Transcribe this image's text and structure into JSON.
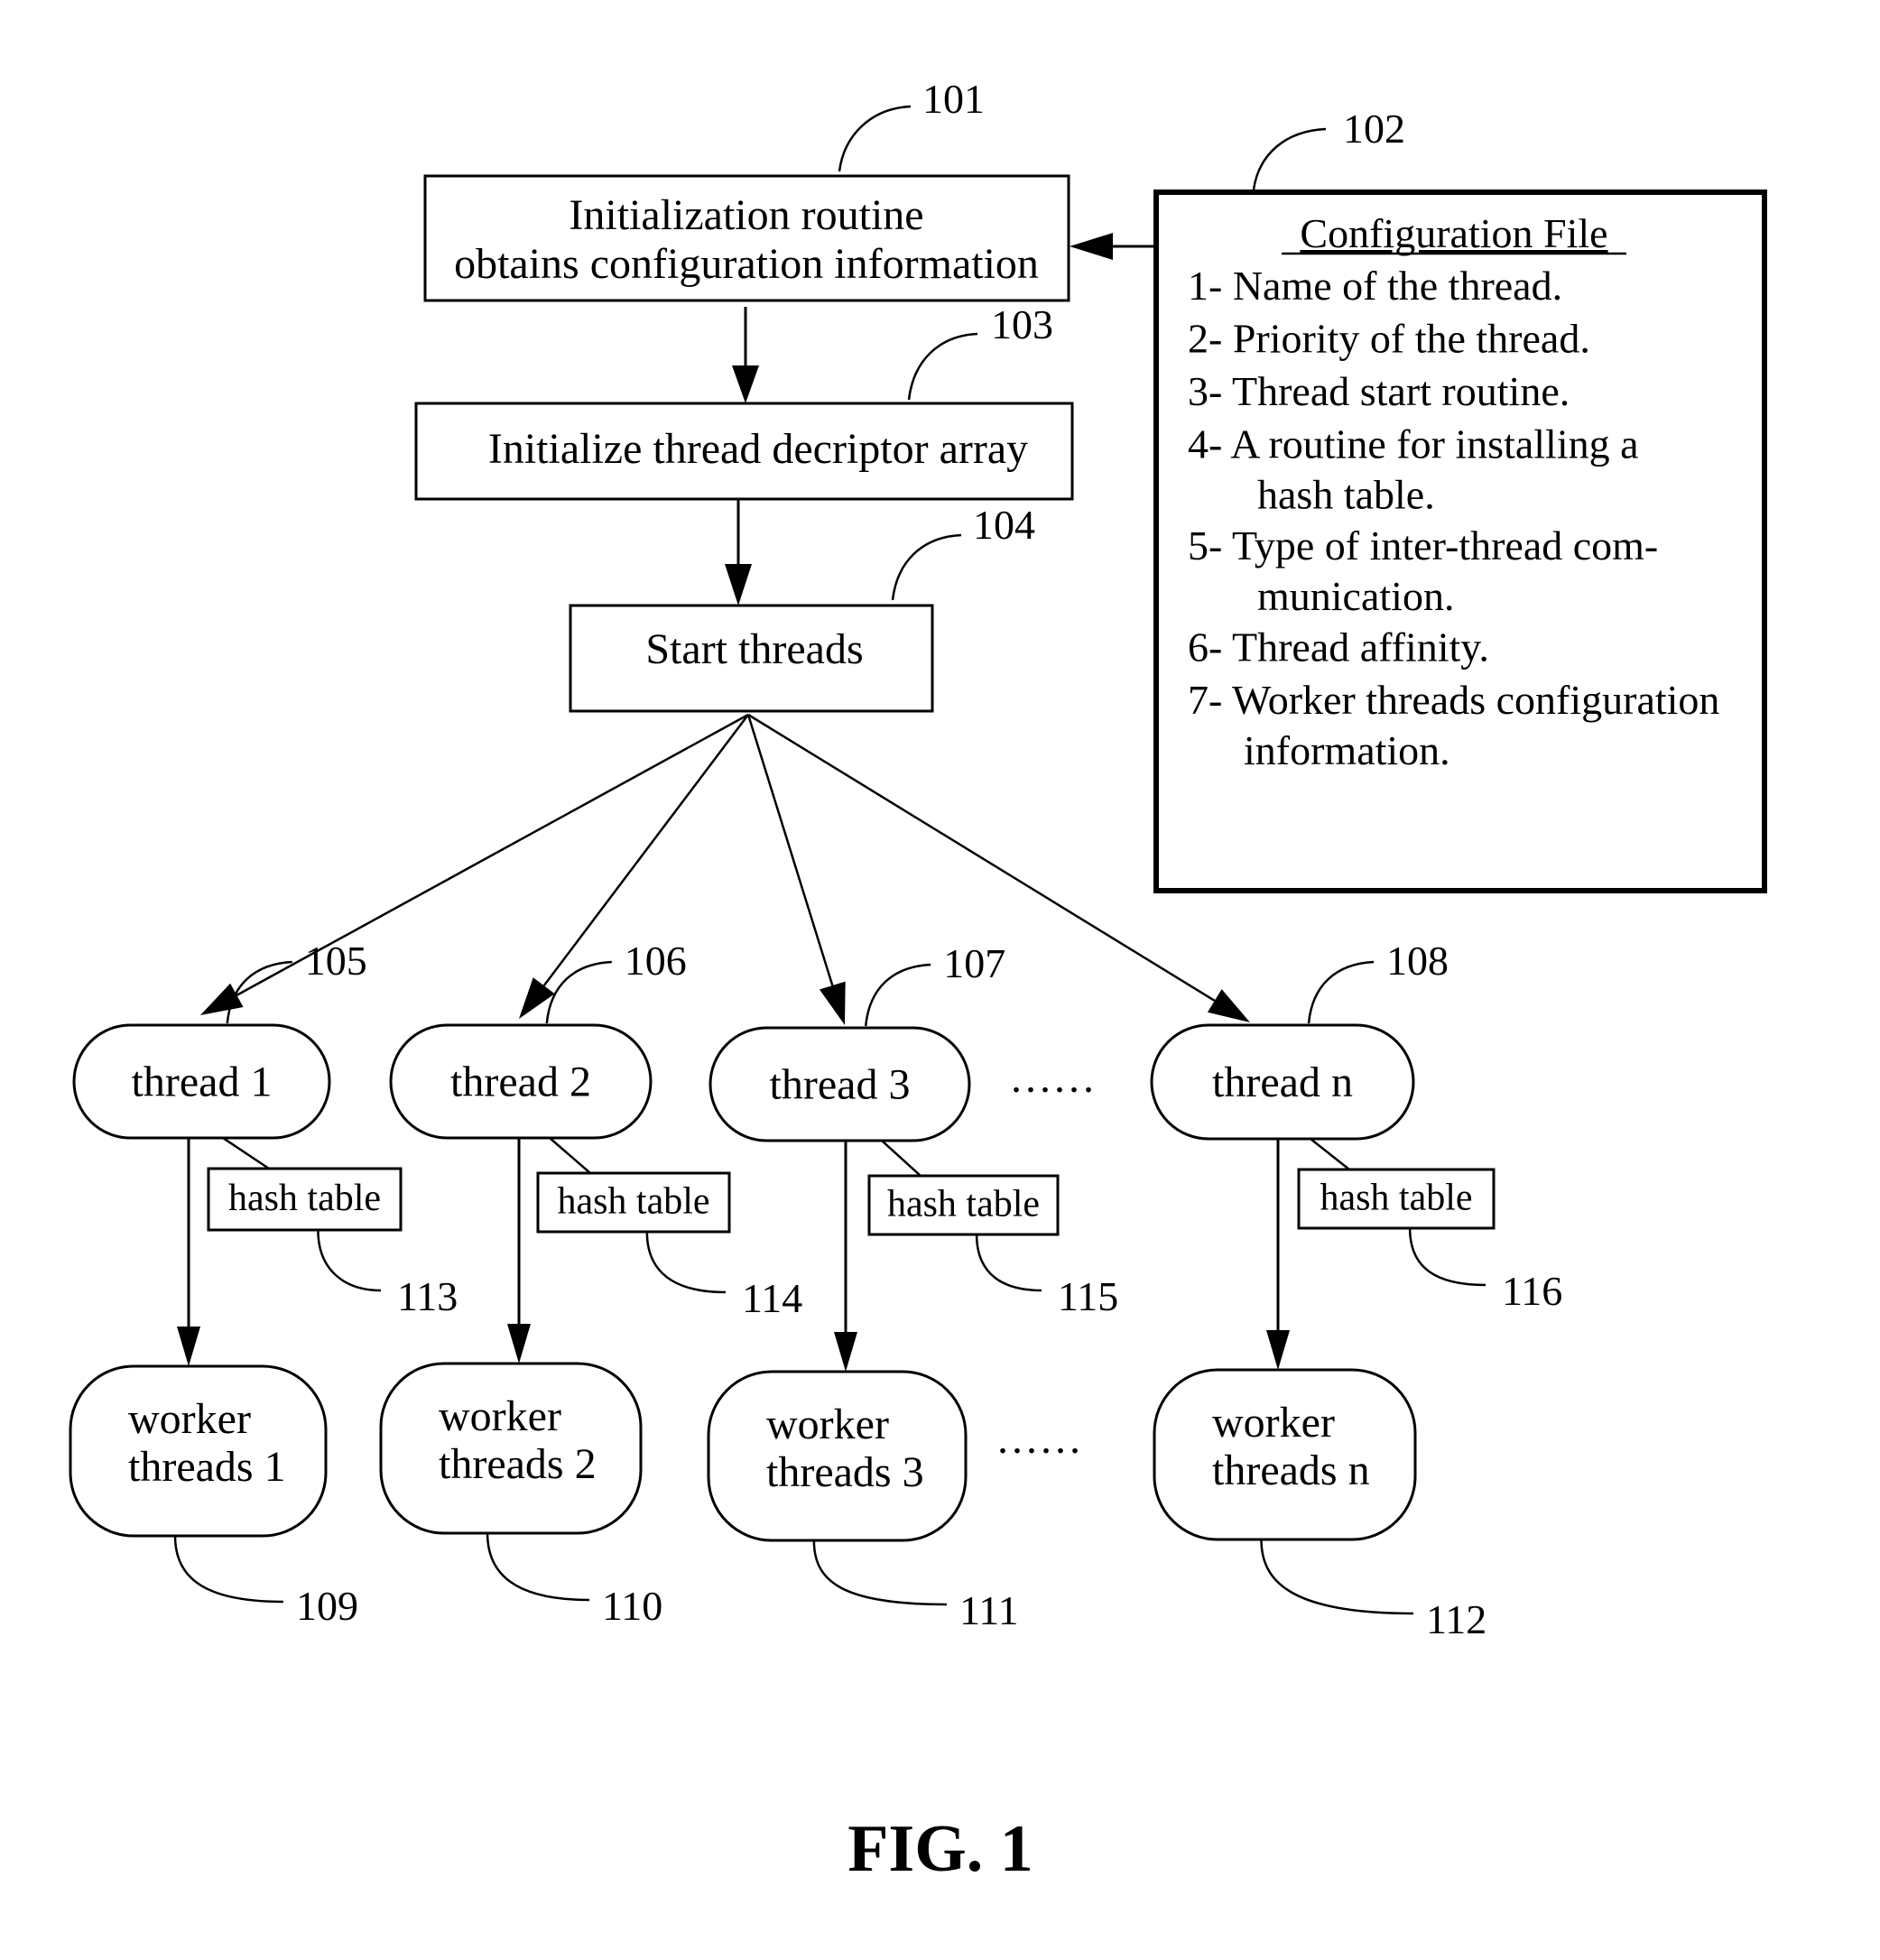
{
  "figure": {
    "caption": "FIG. 1",
    "init_routine": {
      "ref": "101",
      "lines": [
        "Initialization routine",
        "obtains configuration information"
      ]
    },
    "config_file": {
      "ref": "102",
      "title": "Configuration File",
      "items": [
        [
          "1- Name of the thread."
        ],
        [
          "2- Priority of the thread."
        ],
        [
          "3- Thread start routine."
        ],
        [
          "4-  A routine for installing a",
          "hash table."
        ],
        [
          "5- Type of inter-thread com-",
          "munication."
        ],
        [
          "6- Thread affinity."
        ],
        [
          "7- Worker threads configuration",
          "information."
        ]
      ]
    },
    "init_descriptor": {
      "ref": "103",
      "label": "Initialize thread decriptor array"
    },
    "start_threads": {
      "ref": "104",
      "label": "Start threads"
    },
    "threads": [
      {
        "label": "thread 1",
        "ref": "105",
        "hash_label": "hash table",
        "hash_ref": "113",
        "worker_lines": [
          "worker",
          "threads 1"
        ],
        "worker_ref": "109"
      },
      {
        "label": "thread 2",
        "ref": "106",
        "hash_label": "hash table",
        "hash_ref": "114",
        "worker_lines": [
          "worker",
          "threads 2"
        ],
        "worker_ref": "110"
      },
      {
        "label": "thread 3",
        "ref": "107",
        "hash_label": "hash table",
        "hash_ref": "115",
        "worker_lines": [
          "worker",
          "threads 3"
        ],
        "worker_ref": "111"
      },
      {
        "label": "thread n",
        "ref": "108",
        "hash_label": "hash table",
        "hash_ref": "116",
        "worker_lines": [
          "worker",
          "threads n"
        ],
        "worker_ref": "112"
      }
    ],
    "ellipsis": "......"
  }
}
